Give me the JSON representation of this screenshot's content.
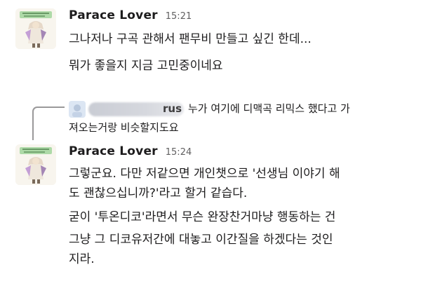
{
  "messages": [
    {
      "username": "Parace Lover",
      "time": "15:21",
      "lines": [
        "그나저나 구곡 관해서 팬무비 만들고 싶긴 한데...",
        "뭐가 좋을지 지금 고민중이네요"
      ]
    },
    {
      "reply": {
        "name_visible": "rus",
        "lines": [
          "누가 여기에 디맥곡 리믹스 했다고 가",
          "져오는거랑 비슷할지도요"
        ]
      },
      "username": "Parace Lover",
      "time": "15:24",
      "lines": [
        "그렇군요. 다만 저같으면 개인챗으로 '선생님 이야기 해",
        "도 괜찮으십니까?'라고 할거 같습다.",
        "굳이 '투온디코'라면서 무슨 완장찬거마냥 행동하는 건",
        "그냥 그 디코유저간에 대놓고 이간질을 하겠다는 것인",
        "지라."
      ]
    }
  ],
  "colors": {
    "text": "#1d1c1d",
    "timestamp": "#616061",
    "connector": "#9a999a"
  },
  "icons": [
    "user-avatar",
    "reply-connector",
    "reply-avatar"
  ]
}
